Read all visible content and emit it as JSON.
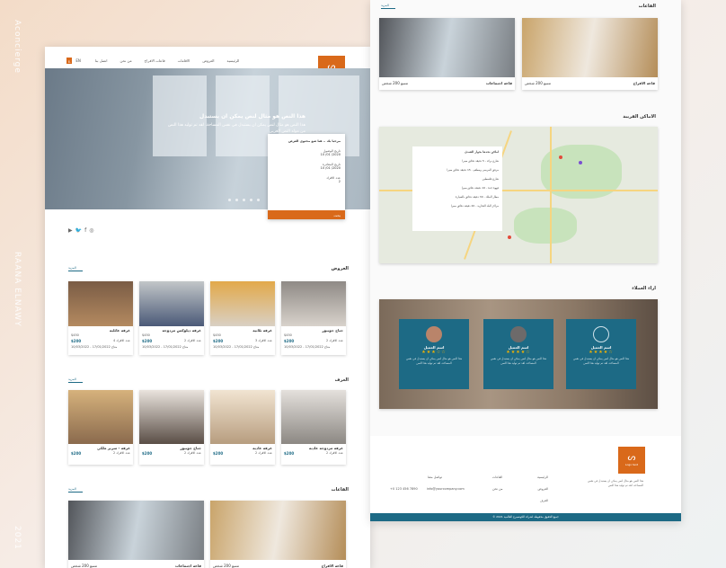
{
  "side": {
    "brand": "Aconcierge",
    "author": "RAANA ELNAWY",
    "year": "2021"
  },
  "nav": {
    "items": [
      "الرئيسية",
      "العروض",
      "الاقامات",
      "قاعات الافراح",
      "من نحن",
      "اتصل بنا"
    ],
    "lang_ar": "ع",
    "lang_en": "EN"
  },
  "logo": {
    "mark": "ᔕ",
    "text": "Logo text"
  },
  "hero": {
    "title": "هذا النص هو مثال لنص يمكن ان يستبدل",
    "body": "هذا النص هو مثال لنص يمكن ان يستبدل في نفس المساحة، لقد تم توليد هذا النص من مولد النص العربي",
    "button": "المزيد",
    "slides": 5
  },
  "booking": {
    "heading": "مرحبا بك .. هنا ضع محتوى الغرض",
    "checkin_label": "تاريخ الوصول",
    "checkin_value": "10 /01 /2020",
    "checkout_label": "تاريخ المغادرة",
    "checkout_value": "10 /01 /2020",
    "guests_label": "عدد الافراد",
    "guests_value": "2",
    "submit": "بحث"
  },
  "social": [
    "▶",
    "🐦",
    "f",
    "◎"
  ],
  "offers": {
    "title": "العروض",
    "more": "المزيد",
    "cards": [
      {
        "name": "غرفة عائلية",
        "price": "$200",
        "old": "$450",
        "guests": "عدد الافراد 4",
        "dates": "متاح 17/01/2022 - 10/03/2022"
      },
      {
        "name": "غرفة ديلوكس مزدوجة",
        "price": "$200",
        "old": "$450",
        "guests": "عدد الافراد 2",
        "dates": "متاح 17/01/2022 - 10/03/2022"
      },
      {
        "name": "غرفة ثلاثية",
        "price": "$200",
        "old": "$450",
        "guests": "عدد الافراد 3",
        "dates": "متاح 17/01/2022 - 10/03/2022"
      },
      {
        "name": "جناح جونيور",
        "price": "$200",
        "old": "$450",
        "guests": "عدد الافراد 2",
        "dates": "متاح 17/01/2022 - 10/03/2022"
      }
    ]
  },
  "rooms": {
    "title": "الغرف",
    "more": "المزيد",
    "cards": [
      {
        "name": "غرفة - سرير ملكي",
        "price": "$200",
        "guests": "عدد الافراد 2"
      },
      {
        "name": "جناح جونيور",
        "price": "$200",
        "guests": "عدد الافراد 2"
      },
      {
        "name": "غرفة عادية",
        "price": "$200",
        "guests": "عدد الافراد 2"
      },
      {
        "name": "غرفة مزدوجة عادية",
        "price": "$200",
        "guests": "عدد الافراد 2"
      }
    ]
  },
  "halls": {
    "title": "القاعات",
    "more": "المزيد",
    "items": [
      {
        "name": "قاعة اجتماعات",
        "cap": "تتسع 200 شخص"
      },
      {
        "name": "قاعة الافراح",
        "cap": "تتسع 200 شخص"
      }
    ]
  },
  "nearby": {
    "title": "الاماكن القريبة",
    "panel_title": "اماكن تجدها بجوار الفندق",
    "items": [
      "شارع بركة - 5 دقيقة دقائق سيرا",
      "مرفق المرسى ومطعم - 15 دقيقة دقائق سيرا",
      "شارع فلسطين",
      "قهوة جدة - 10 دقيقة دقائق سيرا",
      "مطار الملك - 30 دقيقة دقائق بالسيارة",
      "مراكز البلد التجارية - 20 دقيقة دقائق سيرا"
    ]
  },
  "reviews": {
    "title": "اراء العملاء",
    "items": [
      {
        "name": "اسم العميل",
        "stars": "★★★☆☆",
        "quote": "هذا النص هو مثال لنص يمكن ان يستبدل في نفس المساحة، لقد تم توليد هذا النص"
      },
      {
        "name": "اسم العميل",
        "stars": "★★★★☆",
        "quote": "هذا النص هو مثال لنص يمكن ان يستبدل في نفس المساحة، لقد تم توليد هذا النص"
      },
      {
        "name": "اسم العميل",
        "stars": "★★★★☆",
        "quote": "هذا النص هو مثال لنص يمكن ان يستبدل في نفس المساحة، لقد تم توليد هذا النص"
      }
    ]
  },
  "footer": {
    "about": "هذا النص هو مثال لنص يمكن ان يستبدل في نفس المساحة، لقد تم توليد هذا النص",
    "col1": [
      "الرئيسية",
      "العروض",
      "الغرف"
    ],
    "col2": [
      "القاعات",
      "من نحن"
    ],
    "col3": [
      "تواصل معنا",
      "info@yourcompany.com",
      "+0 123 456 7890"
    ],
    "copyright": "© جميع الحقوق محفوظة لشركة الكونسيرج العالمية 2021"
  }
}
